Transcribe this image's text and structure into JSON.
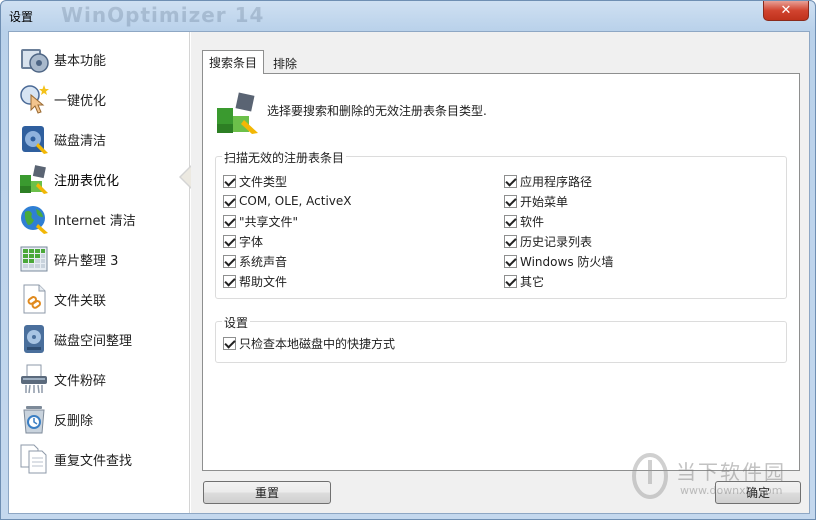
{
  "window": {
    "title": "设置",
    "background_title": "WinOptimizer 14",
    "close_label": "✕"
  },
  "sidebar": {
    "items": [
      {
        "label": "基本功能",
        "icon": "gear-disk-icon"
      },
      {
        "label": "一键优化",
        "icon": "one-click-icon"
      },
      {
        "label": "磁盘清洁",
        "icon": "disk-clean-icon"
      },
      {
        "label": "注册表优化",
        "icon": "registry-icon"
      },
      {
        "label": "Internet 清洁",
        "icon": "globe-icon"
      },
      {
        "label": "碎片整理 3",
        "icon": "defrag-icon"
      },
      {
        "label": "文件关联",
        "icon": "file-link-icon"
      },
      {
        "label": "磁盘空间整理",
        "icon": "disk-space-icon"
      },
      {
        "label": "文件粉碎",
        "icon": "shredder-icon"
      },
      {
        "label": "反删除",
        "icon": "undelete-icon"
      },
      {
        "label": "重复文件查找",
        "icon": "duplicate-icon"
      }
    ],
    "active_index": 3
  },
  "tabs": [
    {
      "label": "搜索条目",
      "active": true
    },
    {
      "label": "排除",
      "active": false
    }
  ],
  "search_tab": {
    "intro": "选择要搜索和删除的无效注册表条目类型.",
    "scan_group": {
      "title": "扫描无效的注册表条目",
      "left": [
        {
          "label": "文件类型",
          "checked": true
        },
        {
          "label": "COM, OLE, ActiveX",
          "checked": true
        },
        {
          "label": "\"共享文件\"",
          "checked": true
        },
        {
          "label": "字体",
          "checked": true
        },
        {
          "label": "系统声音",
          "checked": true
        },
        {
          "label": "帮助文件",
          "checked": true
        }
      ],
      "right": [
        {
          "label": "应用程序路径",
          "checked": true
        },
        {
          "label": "开始菜单",
          "checked": true
        },
        {
          "label": "软件",
          "checked": true
        },
        {
          "label": "历史记录列表",
          "checked": true
        },
        {
          "label": "Windows 防火墙",
          "checked": true
        },
        {
          "label": "其它",
          "checked": true
        }
      ]
    },
    "settings_group": {
      "title": "设置",
      "options": [
        {
          "label": "只检查本地磁盘中的快捷方式",
          "checked": true
        }
      ]
    }
  },
  "buttons": {
    "reset": "重置",
    "ok": "确定"
  },
  "watermark": {
    "text": "当下软件园",
    "url": "www.downxia.com"
  }
}
